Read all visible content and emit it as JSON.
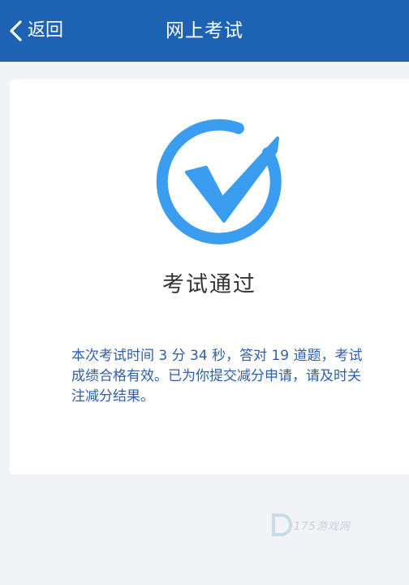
{
  "nav": {
    "back_label": "返回",
    "title": "网上考试"
  },
  "result": {
    "icon": "check-circle-icon",
    "title": "考试通过",
    "message": "本次考试时间 3 分 34 秒，答对 19 道题，考试成绩合格有效。已为你提交减分申请，请及时关注减分结果。"
  },
  "watermark": {
    "text": "175游戏网"
  },
  "colors": {
    "nav_bg": "#1e62b3",
    "check_blue": "#3a9df0",
    "message_text": "#2f5faa",
    "page_bg": "#f2f3f7"
  }
}
